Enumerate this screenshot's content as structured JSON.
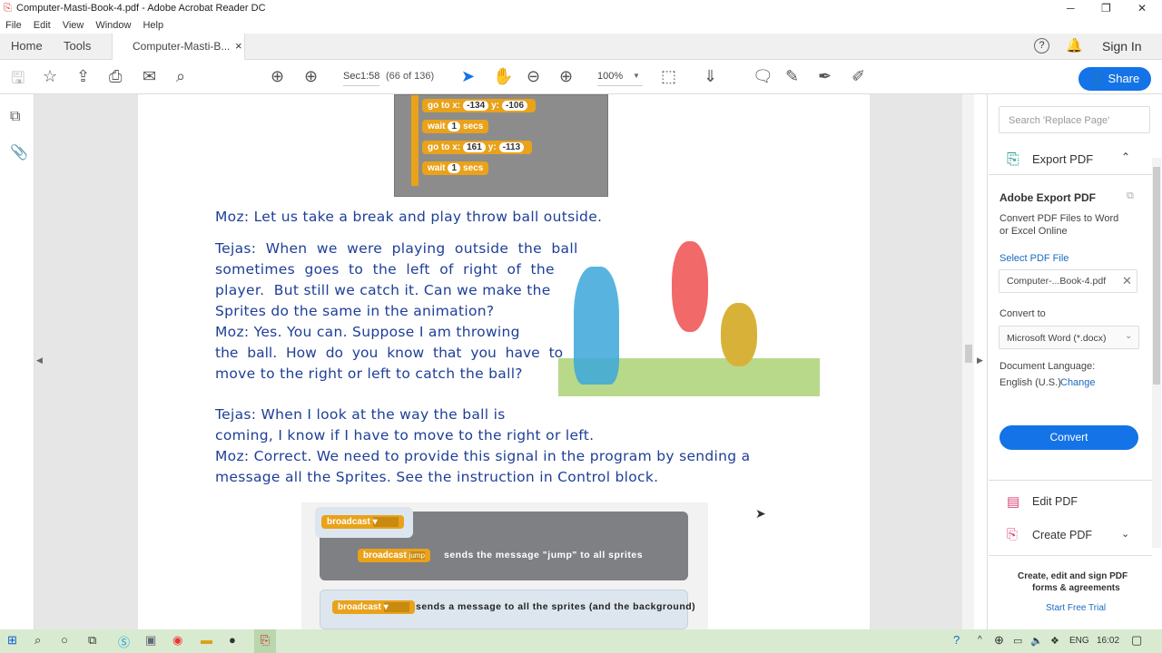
{
  "window": {
    "title": "Computer-Masti-Book-4.pdf - Adobe Acrobat Reader DC",
    "minimize": "─",
    "restore": "❐",
    "close": "✕"
  },
  "menu": [
    "File",
    "Edit",
    "View",
    "Window",
    "Help"
  ],
  "tabs": {
    "home": "Home",
    "tools": "Tools",
    "doc": "Computer-Masti-B...",
    "close": "×",
    "help": "?",
    "signin": "Sign In"
  },
  "toolbar": {
    "page_label": "Sec1:58",
    "page_count": "(66 of 136)",
    "zoom": "100%",
    "share": "Share"
  },
  "scratch_top": [
    {
      "cmd": "go to x:",
      "x": "-134",
      "y": "-106"
    },
    {
      "cmd": "wait",
      "n": "1",
      "unit": "secs"
    },
    {
      "cmd": "go to x:",
      "x": "161",
      "y": "-113"
    },
    {
      "cmd": "wait",
      "n": "1",
      "unit": "secs"
    }
  ],
  "ylabel": "y:",
  "lines": [
    "Moz: Let us take a break and play throw ball outside.",
    "Tejas:  When  we  were  playing  outside  the  ball",
    "sometimes  goes  to  the  left  of  right  of  the",
    "player.  But still we catch it. Can we make the",
    "Sprites do the same in the animation?",
    "Moz: Yes. You can. Suppose I am throwing",
    "the  ball.  How  do  you  know  that  you  have  to",
    "move to the right or left to catch the ball?",
    "Tejas: When I look at the way the ball is",
    "coming, I know if I have to move to the right or left.",
    "Moz: Correct. We need to provide this signal in the program by sending a",
    "message all the Sprites. See the instruction in Control block."
  ],
  "broadcast": {
    "label": "broadcast",
    "jump": "jump",
    "desc1": "sends the message \"jump\" to all sprites",
    "desc2": "sends a message to all the sprites (and the background)"
  },
  "panel": {
    "search_placeholder": "Search 'Replace Page'",
    "export": "Export PDF",
    "heading": "Adobe Export PDF",
    "desc1": "Convert PDF Files to Word",
    "desc2": "or Excel Online",
    "select": "Select PDF File",
    "file": "Computer-...Book-4.pdf",
    "convert_to": "Convert to",
    "format": "Microsoft Word (*.docx)",
    "lang_label": "Document Language:",
    "lang": "English (U.S.)",
    "change": "Change",
    "convert": "Convert",
    "edit": "Edit PDF",
    "create": "Create PDF",
    "promo1": "Create, edit and sign PDF",
    "promo2": "forms & agreements",
    "trial": "Start Free Trial"
  },
  "tray": {
    "lang": "ENG",
    "time": "16:02"
  }
}
